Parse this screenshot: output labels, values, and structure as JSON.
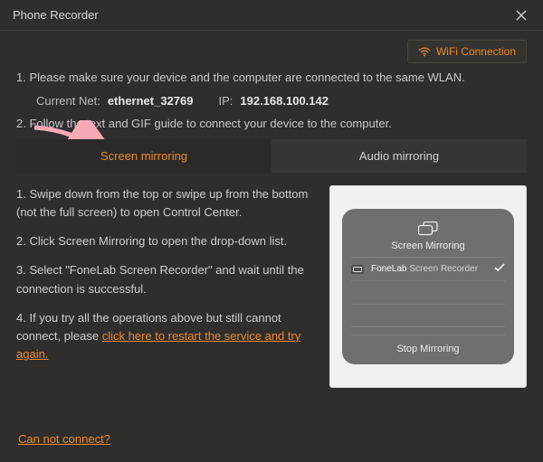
{
  "window": {
    "title": "Phone Recorder"
  },
  "wifi": {
    "label": "WiFi Connection"
  },
  "instructions": {
    "line1": "1. Please make sure your device and the computer are connected to the same WLAN.",
    "net_label": "Current Net:",
    "net_value": "ethernet_32769",
    "ip_label": "IP:",
    "ip_value": "192.168.100.142",
    "line2": "2. Follow the text and GIF guide to connect your device to the computer."
  },
  "tabs": {
    "screen": "Screen mirroring",
    "audio": "Audio mirroring"
  },
  "steps": {
    "s1": "1. Swipe down from the top or swipe up from the bottom (not the full screen) to open Control Center.",
    "s2": "2. Click Screen Mirroring to open the drop-down list.",
    "s3": "3. Select \"FoneLab Screen Recorder\" and wait until the connection is successful.",
    "s4_prefix": "4. If you try all the operations above but still cannot connect, please ",
    "s4_link": "click here to restart the service and try again."
  },
  "preview": {
    "panel_title": "Screen Mirroring",
    "device_brand": "FoneLab",
    "device_name": "Screen Recorder",
    "stop_label": "Stop Mirroring"
  },
  "footer": {
    "cannot_connect": "Can not connect?"
  }
}
